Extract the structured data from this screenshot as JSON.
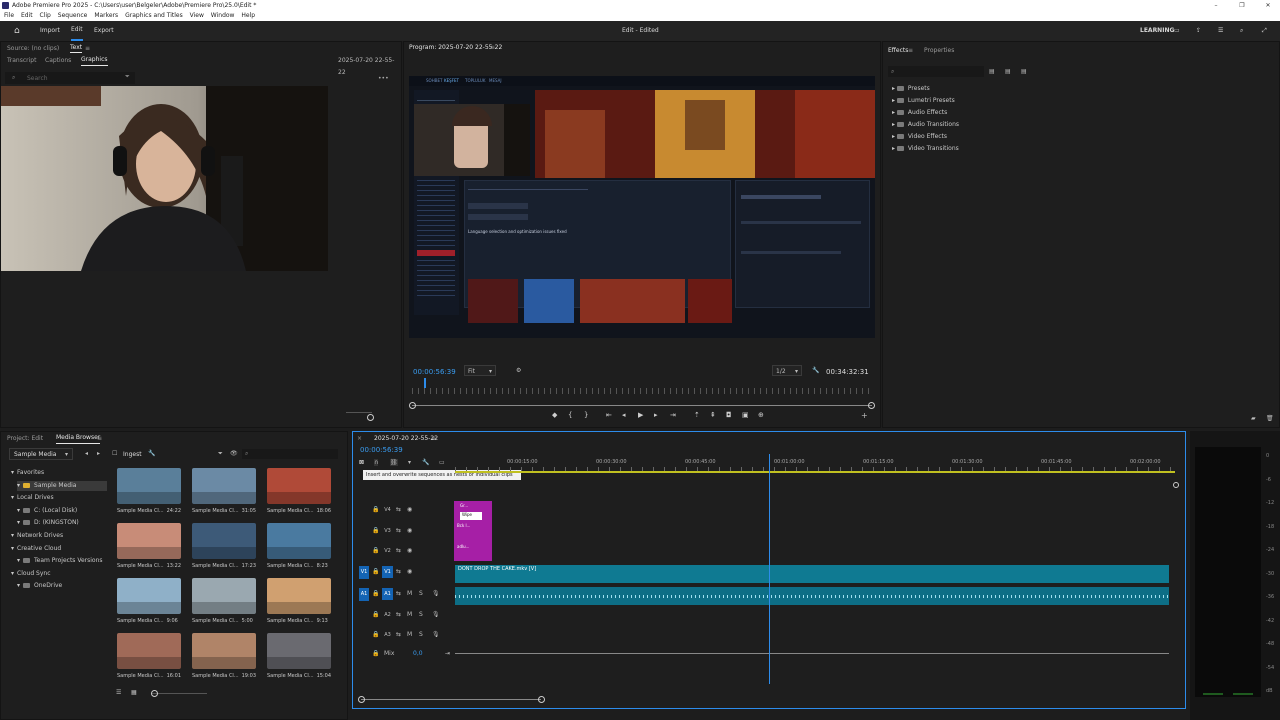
{
  "titlebar": {
    "title": "Adobe Premiere Pro 2025 - C:\\Users\\user\\Belgeler\\Adobe\\Premiere Pro\\25.0\\Edit *",
    "minimize": "–",
    "restore": "❐",
    "close": "✕"
  },
  "menu": [
    "File",
    "Edit",
    "Clip",
    "Sequence",
    "Markers",
    "Graphics and Titles",
    "View",
    "Window",
    "Help"
  ],
  "header": {
    "tabs": [
      "Import",
      "Edit",
      "Export"
    ],
    "active_tab": "Edit",
    "center_title": "Edit - Edited",
    "learning": "LEARNING"
  },
  "source_panel": {
    "source_label": "Source: (no clips)",
    "text_tab": "Text",
    "subtabs": [
      "Transcript",
      "Captions",
      "Graphics"
    ],
    "active_subtab": "Graphics",
    "timestamp": "2025-07-20 22-55-22",
    "search_placeholder": "Search"
  },
  "program_monitor": {
    "title": "Program: 2025-07-20 22-55-22",
    "timecode": "00:00:56:39",
    "fit": "Fit",
    "quality": "1/2",
    "duration": "00:34:32:31",
    "playhead": 0.025
  },
  "effects_panel": {
    "tabs": [
      "Effects",
      "Properties"
    ],
    "items": [
      "Presets",
      "Lumetri Presets",
      "Audio Effects",
      "Audio Transitions",
      "Video Effects",
      "Video Transitions"
    ]
  },
  "project_panel": {
    "tabs": [
      "Project: Edit",
      "Media Browser"
    ],
    "location": "Sample Media",
    "ingest": "Ingest",
    "tree": [
      {
        "label": "Favorites",
        "level": 0
      },
      {
        "label": "Sample Media",
        "level": 1,
        "selected": true
      },
      {
        "label": "Local Drives",
        "level": 0
      },
      {
        "label": "C: (Local Disk)",
        "level": 1
      },
      {
        "label": "D: (KINGSTON)",
        "level": 1
      },
      {
        "label": "Network Drives",
        "level": 0
      },
      {
        "label": "Creative Cloud",
        "level": 0
      },
      {
        "label": "Team Projects Versions",
        "level": 1
      },
      {
        "label": "Cloud Sync",
        "level": 0
      },
      {
        "label": "OneDrive",
        "level": 1
      }
    ],
    "clips": [
      {
        "name": "Sample Media Cl...",
        "duration": "24:22",
        "color": "#5a7f9a"
      },
      {
        "name": "Sample Media Cl...",
        "duration": "31:05",
        "color": "#6b8aa5"
      },
      {
        "name": "Sample Media Cl...",
        "duration": "18:06",
        "color": "#b04a38"
      },
      {
        "name": "Sample Media Cl...",
        "duration": "13:22",
        "color": "#c88c78"
      },
      {
        "name": "Sample Media Cl...",
        "duration": "17:23",
        "color": "#3d5a78"
      },
      {
        "name": "Sample Media Cl...",
        "duration": "8:23",
        "color": "#4a7aa0"
      },
      {
        "name": "Sample Media Cl...",
        "duration": "9:06",
        "color": "#8fb0c8"
      },
      {
        "name": "Sample Media Cl...",
        "duration": "5:00",
        "color": "#9aa8b0"
      },
      {
        "name": "Sample Media Cl...",
        "duration": "9:13",
        "color": "#d0a070"
      },
      {
        "name": "Sample Media Cl...",
        "duration": "16:01",
        "color": "#a06a58"
      },
      {
        "name": "Sample Media Cl...",
        "duration": "19:03",
        "color": "#b08468"
      },
      {
        "name": "Sample Media Cl...",
        "duration": "15:04",
        "color": "#6a6a70"
      }
    ]
  },
  "timeline": {
    "sequence": "2025-07-20 22-55-22",
    "timecode": "00:00:56:39",
    "tooltip": "Insert and overwrite sequences as nests or individual clips",
    "ruler": [
      "00:00:15:00",
      "00:00:30:00",
      "00:00:45:00",
      "00:01:00:00",
      "00:01:15:00",
      "00:01:30:00",
      "00:01:45:00",
      "00:02:00:00"
    ],
    "tracks": [
      "V4",
      "V3",
      "V2",
      "V1",
      "A1",
      "A2",
      "A3"
    ],
    "video_clip": "DONT DROP THE CAKE.mkv [V]",
    "mix_label": "Mix",
    "mix_value": "0,0",
    "small_clips": [
      "Gr...",
      "Wipe",
      "Bck l...",
      "adlu..."
    ]
  },
  "meter": {
    "scale": [
      "0",
      "-6",
      "-12",
      "-18",
      "-24",
      "-30",
      "-36",
      "-42",
      "-48",
      "-54",
      "dB"
    ]
  },
  "colors": {
    "accent": "#2d8ceb",
    "video_clip": "#0f7a92",
    "graphic_clip": "#a61fa6",
    "track_blue": "#1464b4"
  },
  "preview": {
    "nav": [
      "SOHBET",
      "KEŞFET",
      "TOPLULUK",
      "MESAJ"
    ],
    "heading": "Language selection and optimization issues fixed"
  }
}
